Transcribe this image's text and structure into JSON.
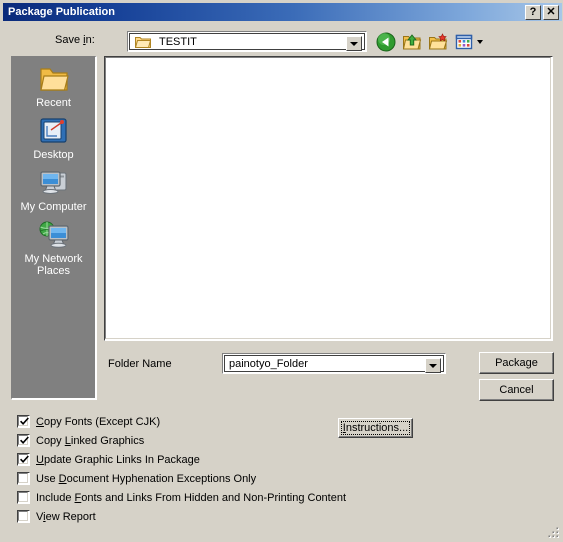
{
  "window": {
    "title": "Package Publication",
    "help_button": "?",
    "close_button": "✕",
    "help_icon_name": "help-icon",
    "close_icon_name": "close-icon"
  },
  "savein": {
    "label_pre": "Save ",
    "label_accel": "i",
    "label_post": "n:",
    "value": "TESTIT",
    "dropdown_icon": "chevron-down-icon"
  },
  "toolbar": {
    "items": [
      {
        "name": "back-button",
        "icon": "back-arrow-icon",
        "tooltip": "Back"
      },
      {
        "name": "up-one-level-button",
        "icon": "up-folder-icon",
        "tooltip": "Up One Level"
      },
      {
        "name": "create-new-folder-button",
        "icon": "new-folder-icon",
        "tooltip": "Create New Folder"
      },
      {
        "name": "views-button",
        "icon": "views-icon",
        "tooltip": "Views"
      }
    ]
  },
  "places": {
    "items": [
      {
        "label": "Recent",
        "icon": "recent-folder-icon"
      },
      {
        "label": "Desktop",
        "icon": "desktop-icon"
      },
      {
        "label": "My Computer",
        "icon": "my-computer-icon"
      },
      {
        "label": "My Network Places",
        "icon": "my-network-places-icon"
      }
    ]
  },
  "filelist": {
    "items": [],
    "empty": true
  },
  "foldername": {
    "label": "Folder Name",
    "value": "painotyo_Folder",
    "dropdown_icon": "chevron-down-icon"
  },
  "buttons": {
    "package": "Package",
    "cancel": "Cancel",
    "instructions_pre": "",
    "instructions_accel": "I",
    "instructions_post": "nstructions..."
  },
  "options": [
    {
      "checked": true,
      "pre": "",
      "accel": "C",
      "post": "opy Fonts (Except CJK)",
      "name": "copy-fonts-checkbox"
    },
    {
      "checked": true,
      "pre": "Copy ",
      "accel": "L",
      "post": "inked Graphics",
      "name": "copy-linked-graphics-checkbox"
    },
    {
      "checked": true,
      "pre": "",
      "accel": "U",
      "post": "pdate Graphic Links In Package",
      "name": "update-graphic-links-checkbox"
    },
    {
      "checked": false,
      "pre": "Use ",
      "accel": "D",
      "post": "ocument Hyphenation Exceptions Only",
      "name": "use-document-hyphenation-checkbox"
    },
    {
      "checked": false,
      "pre": "Include ",
      "accel": "F",
      "post": "onts and Links From Hidden and Non-Printing Content",
      "name": "include-fonts-hidden-checkbox"
    },
    {
      "checked": false,
      "pre": "V",
      "accel": "i",
      "post": "ew Report",
      "name": "view-report-checkbox"
    }
  ],
  "colors": {
    "dialog_face": "#d6d2c8",
    "titlebar_start": "#0a2a7a",
    "titlebar_end": "#a8c7e8",
    "places_bar": "#808080",
    "field_bg": "#ffffff",
    "text": "#000000"
  }
}
